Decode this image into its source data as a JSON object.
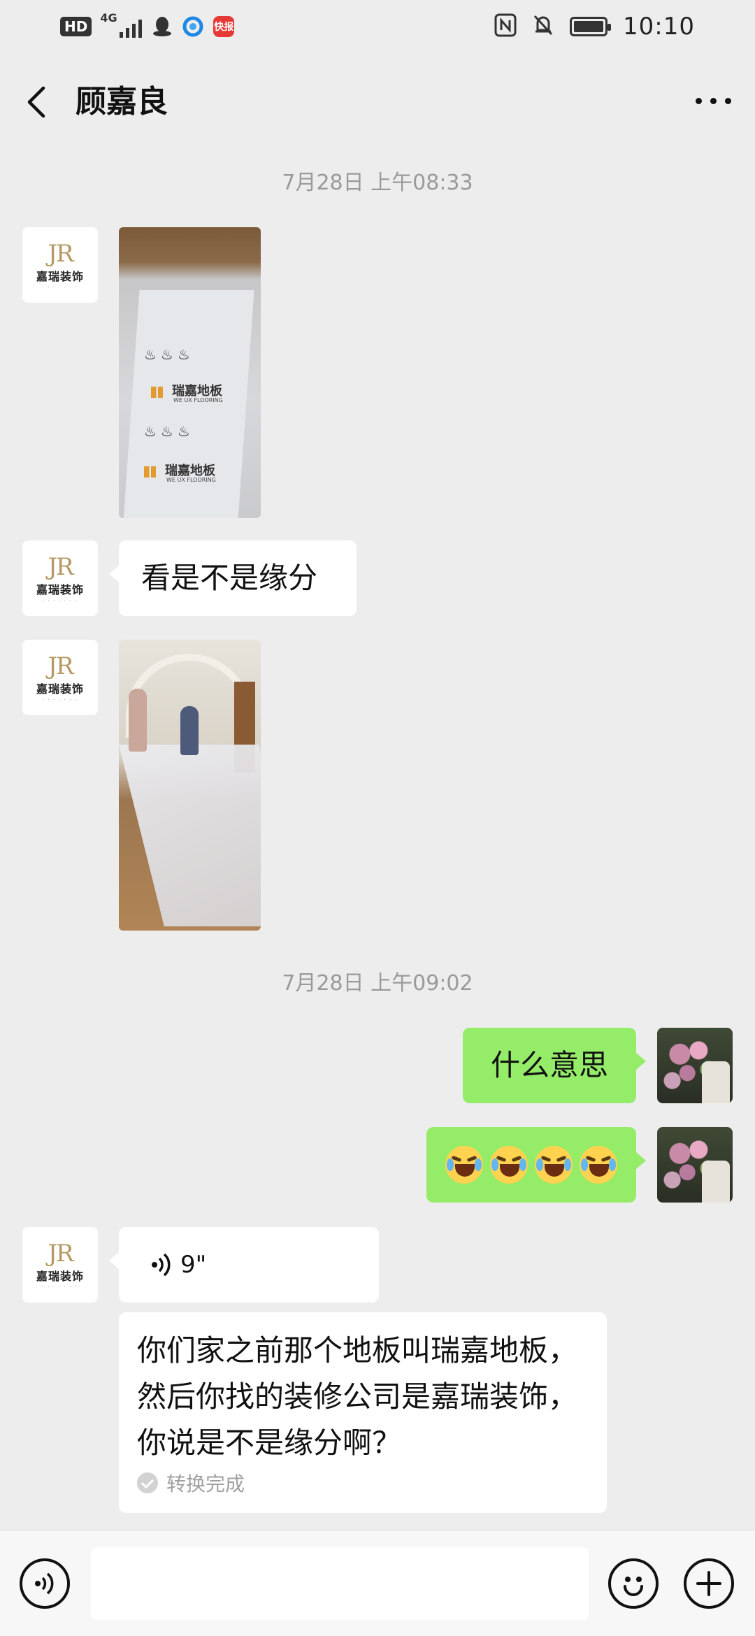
{
  "status_bar": {
    "hd": "HD",
    "network": "4G",
    "time": "10:10",
    "app_badge": "快报",
    "icons": [
      "qq-icon",
      "browser-icon",
      "nfc-icon",
      "mute-bell-icon",
      "battery-icon"
    ]
  },
  "header": {
    "title": "顾嘉良",
    "back_icon": "chevron-left-icon",
    "more_icon": "more-dots-icon"
  },
  "contact_avatar": {
    "monogram": "JR",
    "brand": "嘉瑞装饰"
  },
  "messages": {
    "timestamp_1": "7月28日 上午08:33",
    "text_1": "看是不是缘分",
    "timestamp_2": "7月28日 上午09:02",
    "reply_1": "什么意思",
    "reply_2_emoji": "face-tears-of-joy x4",
    "voice_duration": "9\"",
    "transcript": "你们家之前那个地板叫瑞嘉地板，然后你找的装修公司是嘉瑞装饰，你说是不是缘分啊？",
    "transcript_status": "转换完成"
  },
  "photo_1": {
    "brand_text_1": "瑞嘉地板",
    "brand_sub_1": "WE  UX FLOORING",
    "brand_text_2": "瑞嘉地板",
    "brand_sub_2": "WE  UX FLOORING"
  },
  "colors": {
    "background": "#ededed",
    "sent_bubble": "#95ec69",
    "received_bubble": "#ffffff",
    "timestamp": "#9a9a9a"
  },
  "input_bar": {
    "voice_icon": "voice-mode-icon",
    "emoji_icon": "emoji-smile-icon",
    "plus_icon": "plus-circle-icon",
    "value": ""
  }
}
